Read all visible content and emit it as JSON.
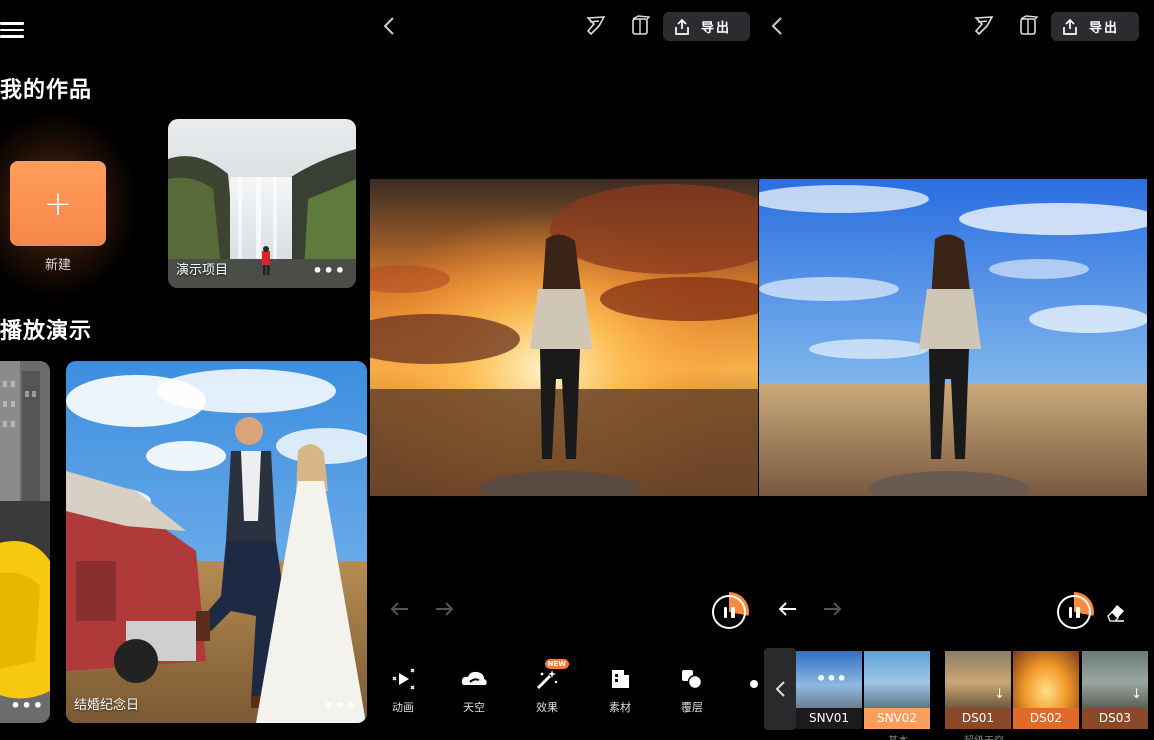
{
  "gallery": {
    "my_works_title": "我的作品",
    "new_label": "新建",
    "projects": [
      {
        "label": "演示项目",
        "more": "•••"
      }
    ],
    "demo_title": "播放演示",
    "demos": [
      {
        "label": "",
        "more": "•••"
      },
      {
        "label": "结婚纪念日",
        "more": "•••"
      }
    ]
  },
  "editor_a": {
    "export_label": "导出",
    "tools": [
      {
        "label": "动画",
        "icon": "animate-icon"
      },
      {
        "label": "天空",
        "icon": "sky-cloud-icon"
      },
      {
        "label": "效果",
        "icon": "effects-wand-icon",
        "badge": "NEW"
      },
      {
        "label": "素材",
        "icon": "material-icon"
      },
      {
        "label": "覆层",
        "icon": "overlay-icon"
      }
    ]
  },
  "editor_b": {
    "export_label": "导出",
    "filters": [
      {
        "name": "SNV01",
        "more": "•••"
      },
      {
        "name": "SNV02",
        "selected": true
      },
      {
        "name": "DS01"
      },
      {
        "name": "DS02"
      },
      {
        "name": "DS03"
      }
    ],
    "group_labels": [
      "基本",
      "超级天空"
    ]
  },
  "colors": {
    "accent": "#ff9d5c",
    "background": "#000000",
    "button_bg": "#2c2c30"
  }
}
